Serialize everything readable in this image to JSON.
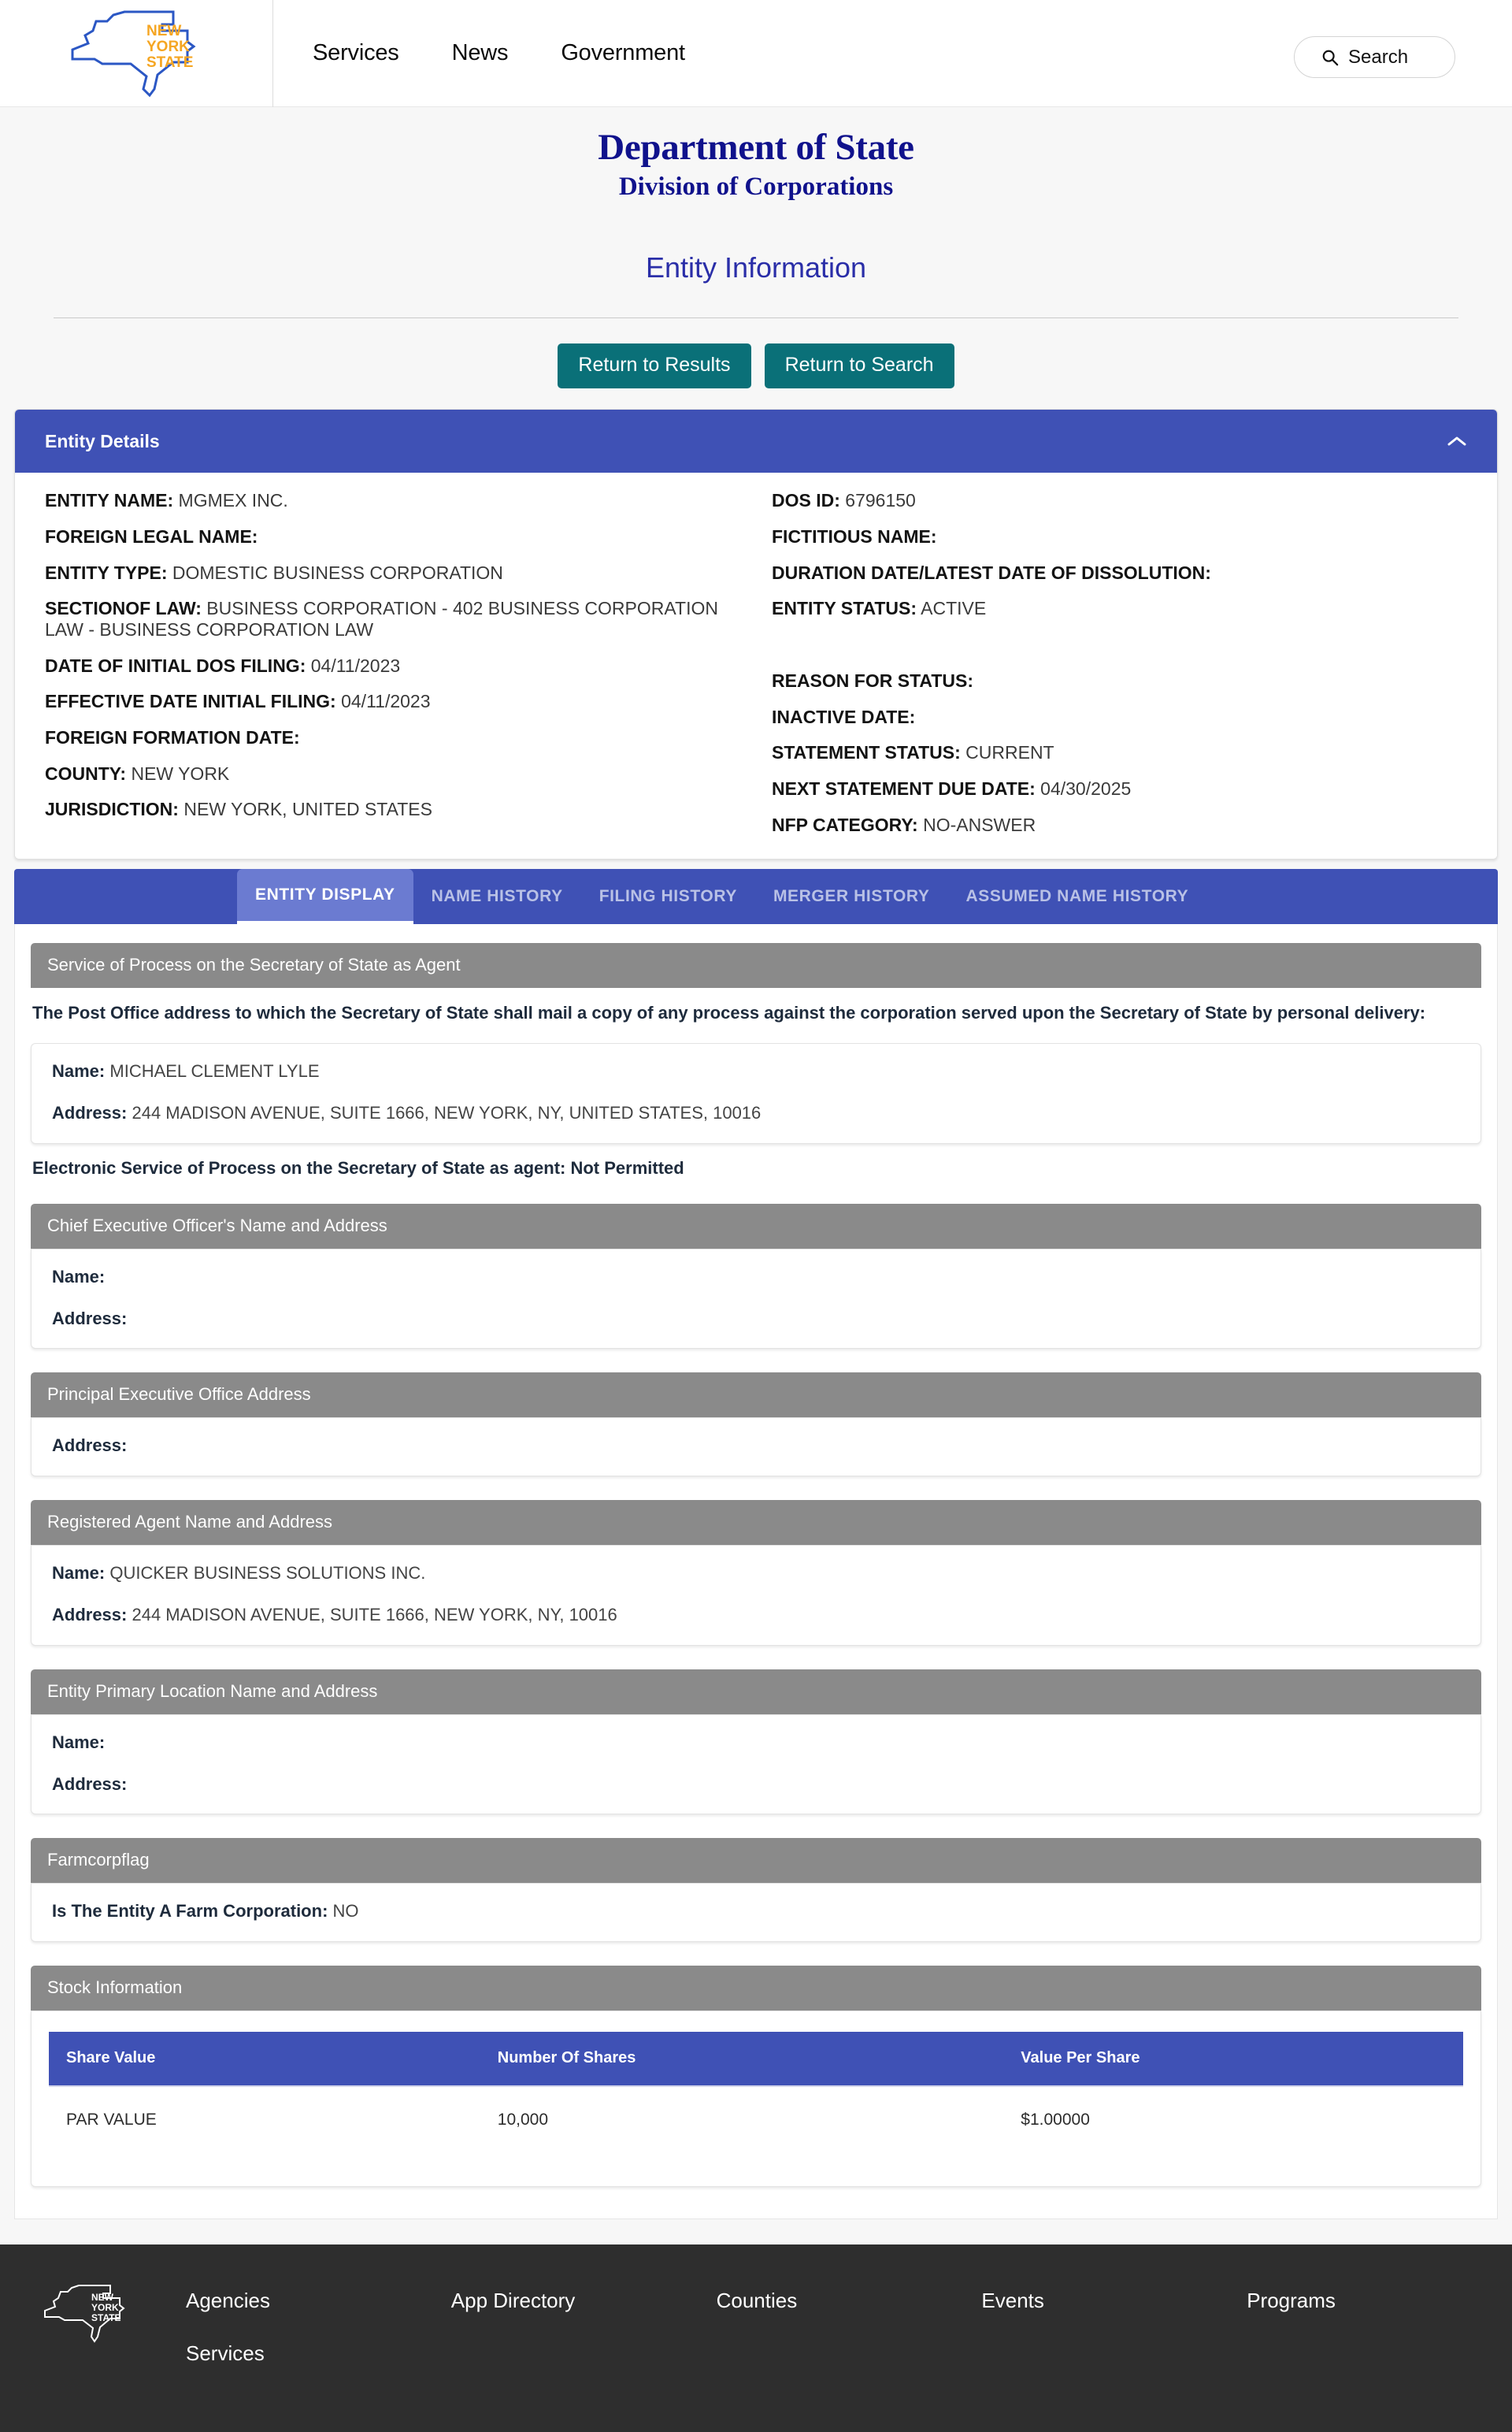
{
  "nav": {
    "logo_alt": "New York State",
    "links": [
      "Services",
      "News",
      "Government"
    ],
    "search_label": "Search"
  },
  "header": {
    "department": "Department of State",
    "division": "Division of Corporations",
    "page_title": "Entity Information",
    "buttons": [
      "Return to Results",
      "Return to Search"
    ]
  },
  "entity_details": {
    "panel_title": "Entity Details",
    "left": [
      {
        "label": "ENTITY NAME:",
        "value": "MGMEX INC."
      },
      {
        "label": "FOREIGN LEGAL NAME:",
        "value": ""
      },
      {
        "label": "ENTITY TYPE:",
        "value": "DOMESTIC BUSINESS CORPORATION"
      },
      {
        "label": "SECTIONOF LAW:",
        "value": "BUSINESS CORPORATION - 402 BUSINESS CORPORATION LAW - BUSINESS CORPORATION LAW"
      },
      {
        "label": "DATE OF INITIAL DOS FILING:",
        "value": "04/11/2023"
      },
      {
        "label": "EFFECTIVE DATE INITIAL FILING:",
        "value": "04/11/2023"
      },
      {
        "label": "FOREIGN FORMATION DATE:",
        "value": ""
      },
      {
        "label": "COUNTY:",
        "value": "NEW YORK"
      },
      {
        "label": "JURISDICTION:",
        "value": "NEW YORK, UNITED STATES"
      }
    ],
    "right": [
      {
        "label": "DOS ID:",
        "value": "6796150"
      },
      {
        "label": "FICTITIOUS NAME:",
        "value": ""
      },
      {
        "label": "DURATION DATE/LATEST DATE OF DISSOLUTION:",
        "value": ""
      },
      {
        "label": "ENTITY STATUS:",
        "value": "ACTIVE"
      },
      {
        "label": "",
        "value": ""
      },
      {
        "label": "REASON FOR STATUS:",
        "value": ""
      },
      {
        "label": "INACTIVE DATE:",
        "value": ""
      },
      {
        "label": "STATEMENT STATUS:",
        "value": "CURRENT"
      },
      {
        "label": "NEXT STATEMENT DUE DATE:",
        "value": "04/30/2025"
      },
      {
        "label": "NFP CATEGORY:",
        "value": "NO-ANSWER"
      }
    ]
  },
  "tabs": [
    {
      "label": "ENTITY DISPLAY",
      "active": true
    },
    {
      "label": "NAME HISTORY",
      "active": false
    },
    {
      "label": "FILING HISTORY",
      "active": false
    },
    {
      "label": "MERGER HISTORY",
      "active": false
    },
    {
      "label": "ASSUMED NAME HISTORY",
      "active": false
    }
  ],
  "sections": {
    "service_of_process": {
      "title": "Service of Process on the Secretary of State as Agent",
      "note": "The Post Office address to which the Secretary of State shall mail a copy of any process against the corporation served upon the Secretary of State by personal delivery:",
      "name_label": "Name:",
      "name_value": "MICHAEL CLEMENT LYLE",
      "address_label": "Address:",
      "address_value": "244 MADISON AVENUE, SUITE 1666, NEW YORK, NY, UNITED STATES, 10016",
      "electronic": "Electronic Service of Process on the Secretary of State as agent: Not Permitted"
    },
    "ceo": {
      "title": "Chief Executive Officer's Name and Address",
      "name_label": "Name:",
      "name_value": "",
      "address_label": "Address:",
      "address_value": ""
    },
    "principal_office": {
      "title": "Principal Executive Office Address",
      "address_label": "Address:",
      "address_value": ""
    },
    "registered_agent": {
      "title": "Registered Agent Name and Address",
      "name_label": "Name:",
      "name_value": "QUICKER BUSINESS SOLUTIONS INC.",
      "address_label": "Address:",
      "address_value": "244 MADISON AVENUE, SUITE 1666, NEW YORK, NY, 10016"
    },
    "primary_location": {
      "title": "Entity Primary Location Name and Address",
      "name_label": "Name:",
      "name_value": "",
      "address_label": "Address:",
      "address_value": ""
    },
    "farmcorpflag": {
      "title": "Farmcorpflag",
      "label": "Is The Entity A Farm Corporation:",
      "value": "NO"
    },
    "stock_information": {
      "title": "Stock Information",
      "columns": [
        "Share Value",
        "Number Of Shares",
        "Value Per Share"
      ],
      "rows": [
        [
          "PAR VALUE",
          "10,000",
          "$1.00000"
        ]
      ]
    }
  },
  "footer": {
    "links": [
      "Agencies",
      "App Directory",
      "Counties",
      "Events",
      "Programs",
      "Services"
    ]
  },
  "colors": {
    "primary_blue": "#3f51b5",
    "tab_active": "#6b7bd1",
    "teal_button": "#0a7078",
    "section_gray": "#8a8a8a",
    "heading_navy": "#10128c",
    "footer_dark": "#2e2e2e",
    "logo_orange": "#f5a623"
  }
}
